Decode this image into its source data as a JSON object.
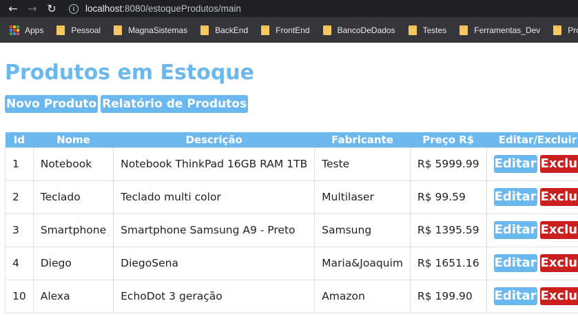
{
  "browser": {
    "url_host": "localhost",
    "url_rest": ":8080/estoqueProdutos/main",
    "bookmarks": [
      "Apps",
      "Pessoal",
      "MagnaSistemas",
      "BackEnd",
      "FrontEnd",
      "BancoDeDados",
      "Testes",
      "Ferramentas_Dev",
      "Projeto"
    ]
  },
  "page": {
    "title": "Produtos em Estoque",
    "new_product_label": "Novo Produto",
    "report_label": "Relatório de Produtos"
  },
  "table": {
    "headers": [
      "Id",
      "Nome",
      "Descrição",
      "Fabricante",
      "Preço R$",
      "Editar/Excluir"
    ],
    "rows": [
      {
        "id": "1",
        "nome": "Notebook",
        "descricao": "Notebook ThinkPad 16GB RAM 1TB",
        "fabricante": "Teste",
        "preco": "R$ 5999.99"
      },
      {
        "id": "2",
        "nome": "Teclado",
        "descricao": "Teclado multi color",
        "fabricante": "Multilaser",
        "preco": "R$ 99.59"
      },
      {
        "id": "3",
        "nome": "Smartphone",
        "descricao": "Smartphone Samsung A9 - Preto",
        "fabricante": "Samsung",
        "preco": "R$ 1395.59"
      },
      {
        "id": "4",
        "nome": "Diego",
        "descricao": "DiegoSena",
        "fabricante": "Maria&Joaquim",
        "preco": "R$ 1651.16"
      },
      {
        "id": "10",
        "nome": "Alexa",
        "descricao": "EchoDot 3 geração",
        "fabricante": "Amazon",
        "preco": "R$ 199.90"
      }
    ],
    "edit_label": "Editar",
    "delete_label": "Excluir"
  },
  "colors": {
    "accent": "#6bb8ef",
    "danger": "#cc1f1f"
  }
}
